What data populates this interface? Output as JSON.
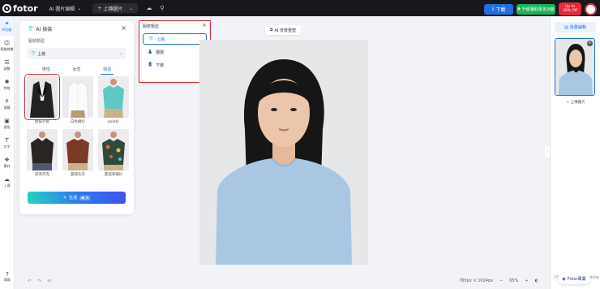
{
  "topbar": {
    "logo": "fotor",
    "app_title": "AI 圖片編輯",
    "upload_label": "上傳圖片",
    "download_label": "下載",
    "upgrade_label": "升級獲取更多功能",
    "offer_line1": "Up to",
    "offer_line2": "30% Off"
  },
  "leftnav": {
    "items": [
      {
        "label": "AI功能",
        "icon": "sparkle-icon"
      },
      {
        "label": "智能辨識",
        "icon": "face-icon"
      },
      {
        "label": "調整",
        "icon": "sliders-icon"
      },
      {
        "label": "特效",
        "icon": "effects-icon"
      },
      {
        "label": "濾鏡",
        "icon": "filter-icon"
      },
      {
        "label": "邊框",
        "icon": "frame-icon"
      },
      {
        "label": "文字",
        "icon": "text-icon"
      },
      {
        "label": "素材",
        "icon": "element-icon"
      },
      {
        "label": "上傳",
        "icon": "upload-icon"
      }
    ],
    "bottom_label": "幫助"
  },
  "panel": {
    "title": "AI 換裝",
    "clothing_type_label": "服裝類型",
    "clothing_type_value": "上裝",
    "tabs": [
      "男性",
      "女性",
      "情侶"
    ],
    "items": [
      {
        "caption": "西裝外套"
      },
      {
        "caption": "白色襯衫"
      },
      {
        "caption": "polo衫"
      },
      {
        "caption": "皮革夾克"
      },
      {
        "caption": "農場毛衣"
      },
      {
        "caption": "夏威夷襯衫"
      }
    ],
    "generate_label": "生成",
    "generate_cost": "2"
  },
  "dropdown": {
    "title": "服裝類型",
    "options": [
      "上裝",
      "整裝",
      "下裝"
    ],
    "selected": "上裝"
  },
  "canvas": {
    "tool_label": "AI 背景重塑"
  },
  "bottombar": {
    "dimensions": "765px × 1024px",
    "zoom": "65%"
  },
  "rightpanel": {
    "batch_label": "批量編輯",
    "upload_label": "上傳圖片",
    "count": "1/50",
    "clear_label": "清除所有"
  },
  "fotor_pro": "Fotor專業"
}
